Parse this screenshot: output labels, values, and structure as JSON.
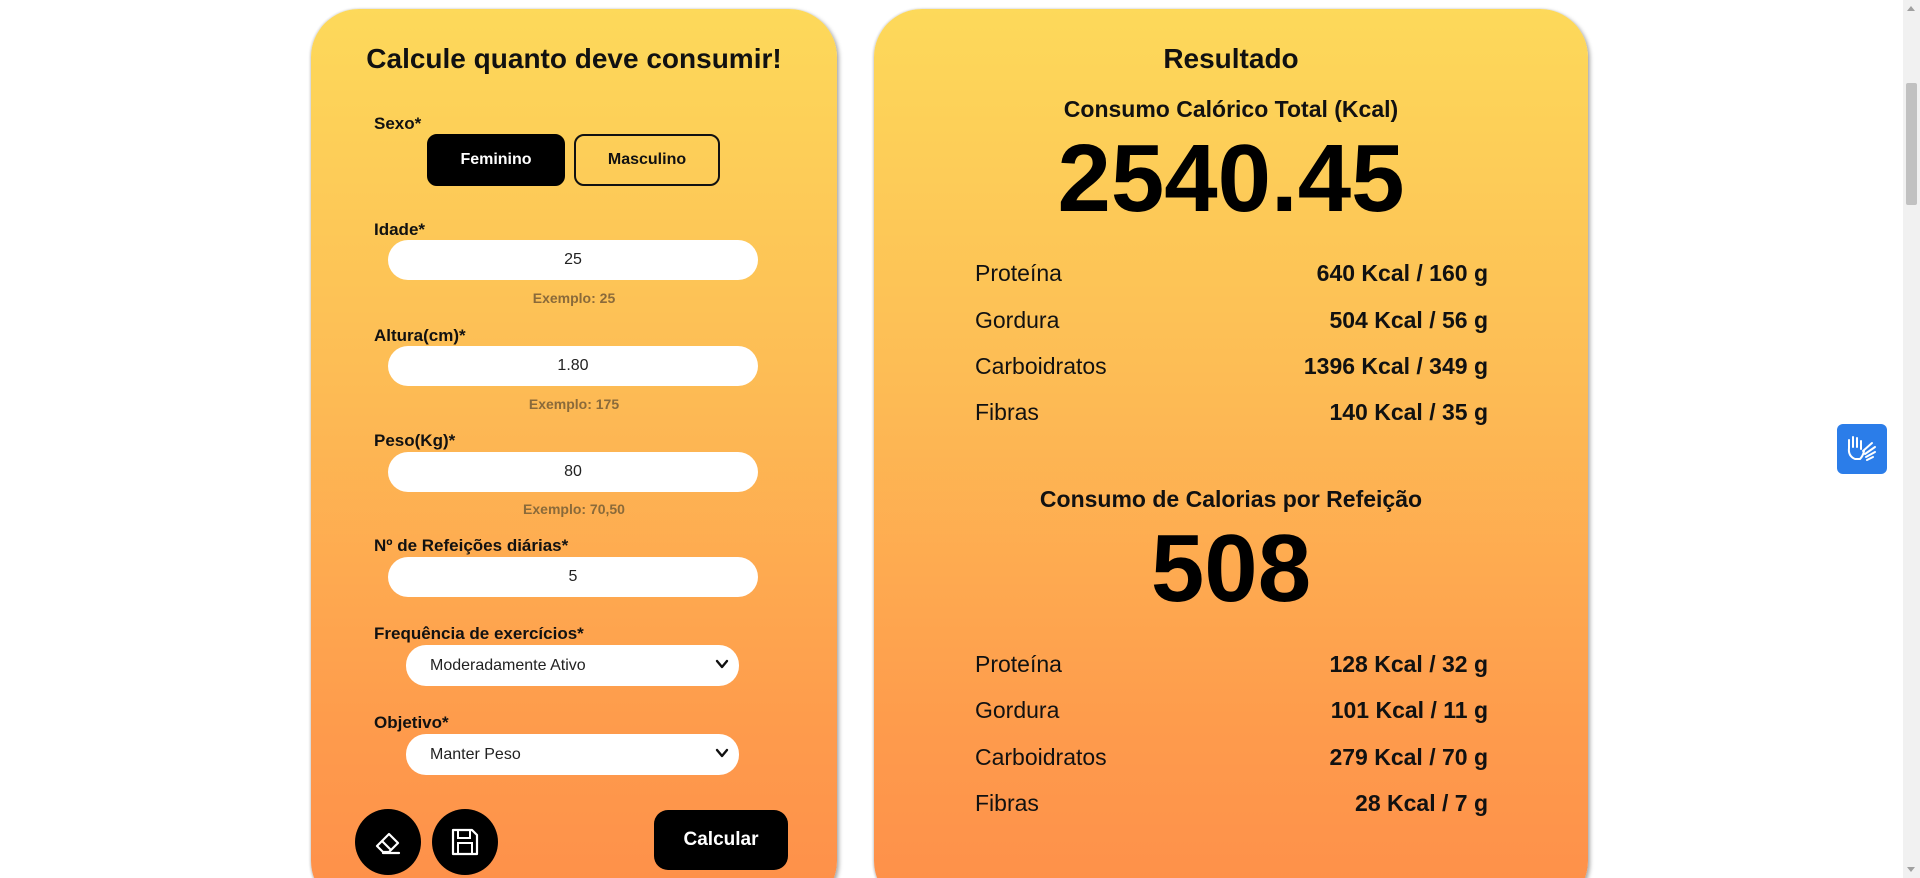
{
  "form": {
    "title": "Calcule quanto deve consumir!",
    "sex_label": "Sexo*",
    "sex_options": [
      "Feminino",
      "Masculino"
    ],
    "sex_selected": "Feminino",
    "age_label": "Idade*",
    "age_value": "25",
    "age_hint": "Exemplo: 25",
    "height_label": "Altura(cm)*",
    "height_value": "1.80",
    "height_hint": "Exemplo: 175",
    "weight_label": "Peso(Kg)*",
    "weight_value": "80",
    "weight_hint": "Exemplo: 70,50",
    "meals_label": "Nº de Refeições diárias*",
    "meals_value": "5",
    "exercise_label": "Frequência de exercícios*",
    "exercise_selected": "Moderadamente Ativo",
    "goal_label": "Objetivo*",
    "goal_selected": "Manter Peso",
    "calculate_label": "Calcular",
    "clear_icon": "eraser-icon",
    "save_icon": "floppy-disk-icon"
  },
  "result": {
    "title": "Resultado",
    "total_label": "Consumo Calórico Total (Kcal)",
    "total_value": "2540.45",
    "total_macros": [
      {
        "name": "Proteína",
        "value": "640 Kcal / 160 g"
      },
      {
        "name": "Gordura",
        "value": "504 Kcal / 56 g"
      },
      {
        "name": "Carboidratos",
        "value": "1396 Kcal / 349 g"
      },
      {
        "name": "Fibras",
        "value": "140 Kcal / 35 g"
      }
    ],
    "meal_label": "Consumo de Calorias por Refeição",
    "meal_value": "508",
    "meal_macros": [
      {
        "name": "Proteína",
        "value": "128 Kcal / 32 g"
      },
      {
        "name": "Gordura",
        "value": "101 Kcal / 11 g"
      },
      {
        "name": "Carboidratos",
        "value": "279 Kcal / 70 g"
      },
      {
        "name": "Fibras",
        "value": "28 Kcal / 7 g"
      }
    ]
  },
  "accessibility": {
    "icon": "sign-language-hands-icon"
  },
  "colors": {
    "card_gradient_top": "#fdd95a",
    "card_gradient_bottom": "#fe8f4a",
    "button_dark": "#000000",
    "a11y_blue": "#2b7de9"
  }
}
